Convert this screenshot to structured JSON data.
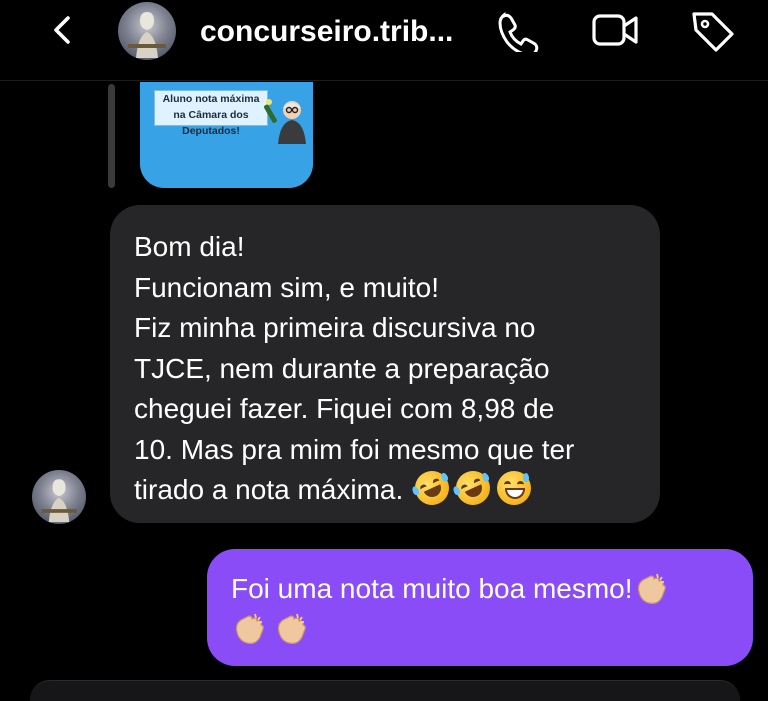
{
  "header": {
    "title": "concurseiro.trib...",
    "icons": [
      "chevron-left-icon",
      "phone-icon",
      "video-camera-icon",
      "tag-icon"
    ]
  },
  "shared_post": {
    "note": "Aluno nota máxima na Câmara dos Deputados!",
    "color": "#37a3e6"
  },
  "incoming_message": {
    "lines": [
      "Bom dia!",
      "Funcionam sim, e muito!",
      "Fiz minha primeira discursiva no",
      "TJCE, nem durante a preparação",
      "cheguei fazer. Fiquei com 8,98 de",
      "10. Mas pra mim foi mesmo que ter",
      "tirado a nota máxima."
    ],
    "emojis": [
      "rolling-laughing-emoji",
      "rolling-laughing-emoji",
      "grinning-sweat-emoji"
    ],
    "color": "#262628"
  },
  "outgoing_message": {
    "text": "Foi uma nota muito boa mesmo!",
    "emojis": [
      "clapping-hands-emoji",
      "clapping-hands-emoji",
      "clapping-hands-emoji"
    ],
    "color": "#8a4cf6"
  }
}
